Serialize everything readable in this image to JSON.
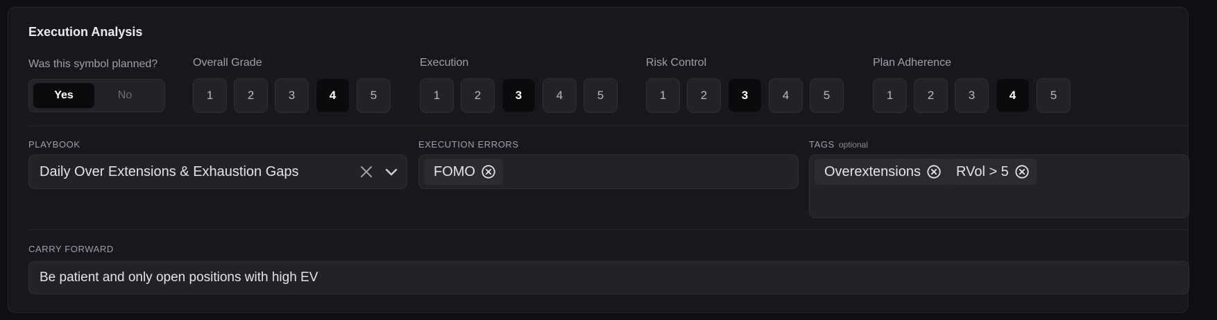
{
  "section_title": "Execution Analysis",
  "planned": {
    "label": "Was this symbol planned?",
    "options": [
      "Yes",
      "No"
    ],
    "selected": "Yes"
  },
  "grades": [
    {
      "label": "Overall Grade",
      "options": [
        "1",
        "2",
        "3",
        "4",
        "5"
      ],
      "selected": "4"
    },
    {
      "label": "Execution",
      "options": [
        "1",
        "2",
        "3",
        "4",
        "5"
      ],
      "selected": "3"
    },
    {
      "label": "Risk Control",
      "options": [
        "1",
        "2",
        "3",
        "4",
        "5"
      ],
      "selected": "3"
    },
    {
      "label": "Plan Adherence",
      "options": [
        "1",
        "2",
        "3",
        "4",
        "5"
      ],
      "selected": "4"
    }
  ],
  "playbook": {
    "label": "PLAYBOOK",
    "value": "Daily Over Extensions & Exhaustion Gaps"
  },
  "execution_errors": {
    "label": "EXECUTION ERRORS",
    "chips": [
      "FOMO"
    ]
  },
  "tags": {
    "label": "TAGS",
    "optional_label": "optional",
    "chips": [
      "Overextensions",
      "RVol > 5"
    ]
  },
  "carry_forward": {
    "label": "CARRY FORWARD",
    "value": "Be patient and only open positions with high EV"
  },
  "colors": {
    "selected_bg": "#0b0b0e",
    "button_bg": "#222228",
    "card_bg": "#17171d"
  }
}
